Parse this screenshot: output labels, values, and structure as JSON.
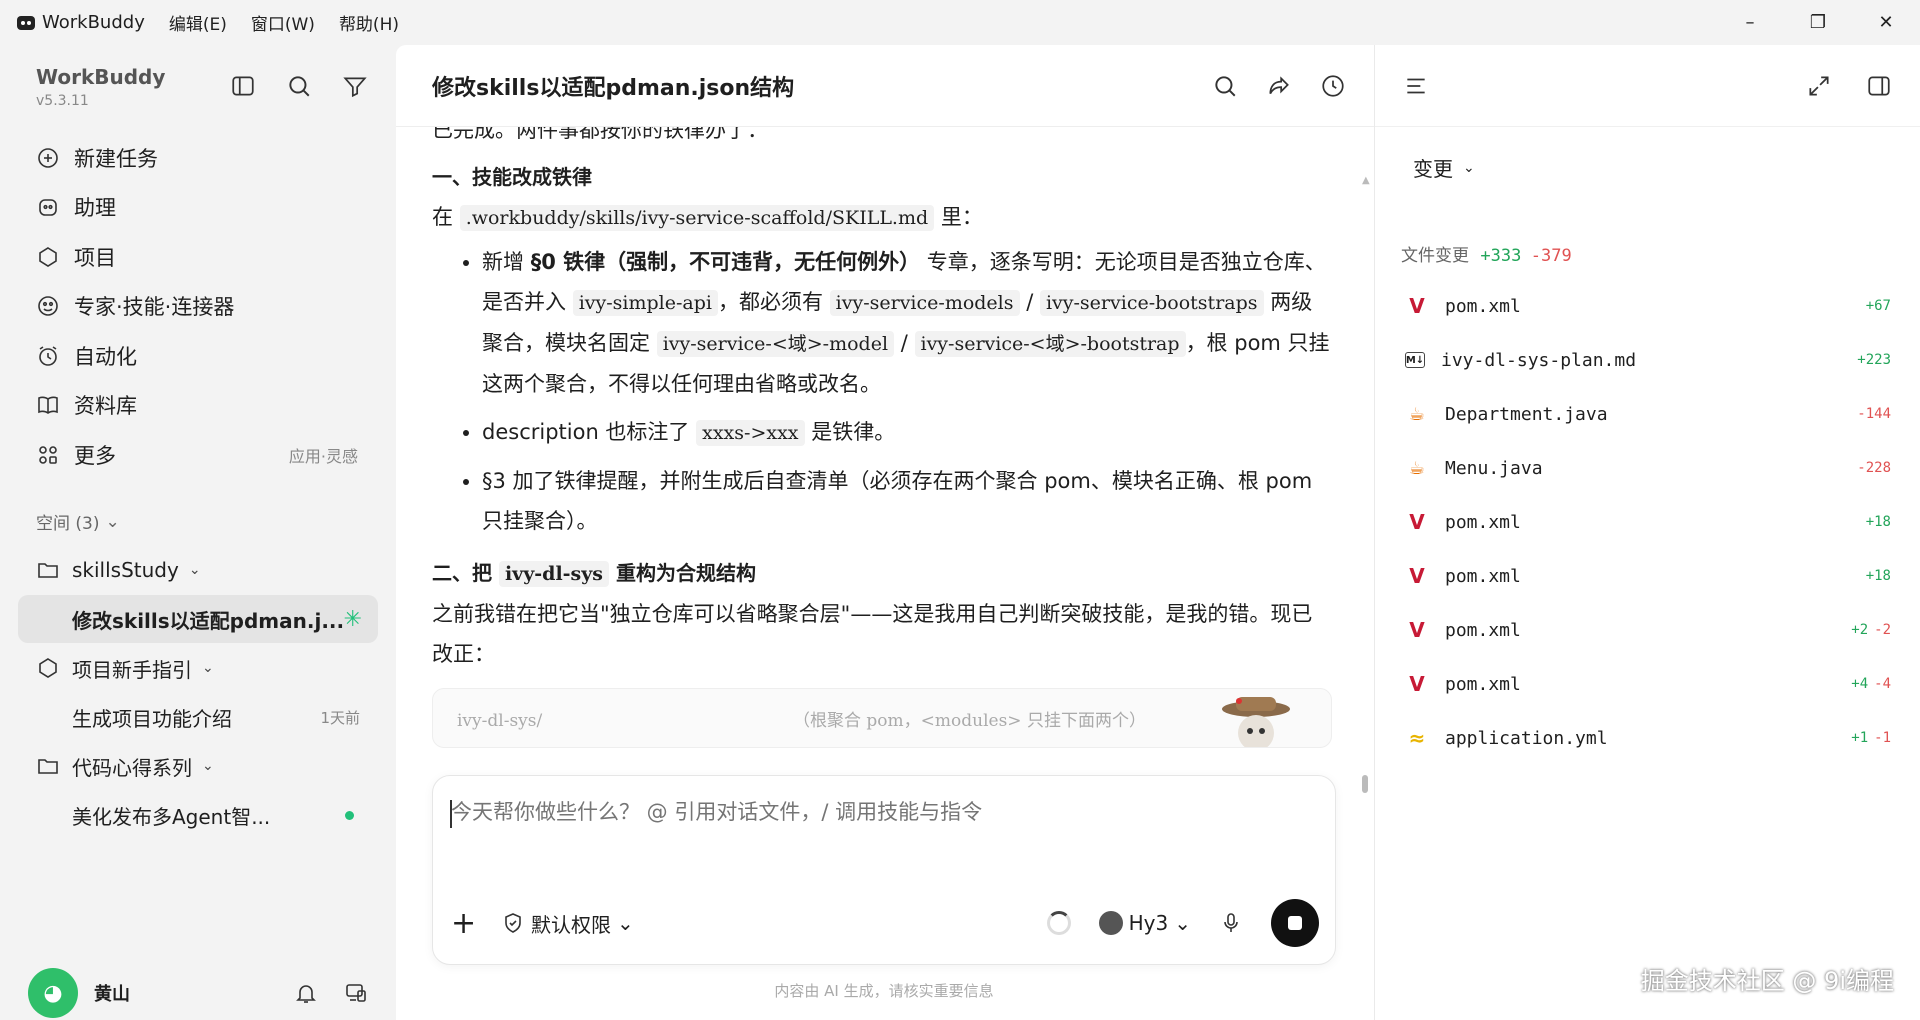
{
  "window": {
    "app_name": "WorkBuddy",
    "menus": [
      "编辑(E)",
      "窗口(W)",
      "帮助(H)"
    ],
    "controls": {
      "minimize": "–",
      "restore": "❐",
      "close": "✕"
    }
  },
  "sidebar": {
    "brand": "WorkBuddy",
    "version": "v5.3.11",
    "nav": [
      {
        "label": "新建任务",
        "icon": "new-task-icon"
      },
      {
        "label": "助理",
        "icon": "assistant-icon"
      },
      {
        "label": "项目",
        "icon": "project-icon"
      },
      {
        "label": "专家·技能·连接器",
        "icon": "expert-icon"
      },
      {
        "label": "自动化",
        "icon": "alarm-clock-icon"
      },
      {
        "label": "资料库",
        "icon": "book-icon"
      },
      {
        "label": "更多",
        "icon": "apps-icon",
        "hint": "应用·灵感"
      }
    ],
    "spaces_label": "空间 (3)",
    "tree": {
      "folder1": "skillsStudy",
      "task_active": "修改skills以适配pdman.j...",
      "folder2": "项目新手指引",
      "task2": "生成项目功能介绍",
      "task2_meta": "1天前",
      "folder3": "代码心得系列",
      "task3": "美化发布多Agent智..."
    },
    "user": {
      "name": "黄山"
    }
  },
  "main": {
    "title": "修改skills以适配pdman.json结构",
    "cut_line": "已完成。两件事都按你的铁律办了：",
    "section1": {
      "heading": "一、技能改成铁律",
      "intro_prefix": "在",
      "intro_path": ".workbuddy/skills/ivy-service-scaffold/SKILL.md",
      "intro_suffix": "里：",
      "b1_a": "新增",
      "b1_strong": "§0 铁律（强制，不可违背，无任何例外）",
      "b1_b": "专章，逐条写明：无论项目是否独立仓库、是否并入",
      "b1_code1": "ivy-simple-api",
      "b1_c": "，都必须有",
      "b1_code2": "ivy-service-models",
      "b1_sep1": "/",
      "b1_code3": "ivy-service-bootstraps",
      "b1_d": "两级聚合，模块名固定",
      "b1_code4": "ivy-service-<域>-model",
      "b1_sep2": "/",
      "b1_code5": "ivy-service-<域>-bootstrap",
      "b1_e": "，根 pom 只挂这两个聚合，不得以任何理由省略或改名。",
      "b2_a": "description 也标注了",
      "b2_code": "xxxs->xxx",
      "b2_b": "是铁律。",
      "b3": "§3 加了铁律提醒，并附生成后自查清单（必须存在两个聚合 pom、模块名正确、根 pom 只挂聚合）。"
    },
    "section2": {
      "heading_a": "二、把",
      "heading_code": "ivy-dl-sys",
      "heading_b": "重构为合规结构",
      "para": "之前我错在把它当\"独立仓库可以省略聚合层\"——这是我用自己判断突破技能，是我的错。现已改正："
    },
    "codeblock": {
      "path": "ivy-dl-sys/",
      "comment": "（根聚合 pom，<modules> 只挂下面两个）"
    },
    "composer": {
      "placeholder": "今天帮你做些什么？ @ 引用对话文件，/ 调用技能与指令",
      "permission": "默认权限",
      "model": "Hy3"
    },
    "disclaimer": "内容由 AI 生成，请核实重要信息"
  },
  "right": {
    "dropdown": "变更",
    "header_label": "文件变更",
    "total_add": "+333",
    "total_del": "-379",
    "files": [
      {
        "name": "pom.xml",
        "icon": "maven-icon",
        "add": "+67",
        "del": ""
      },
      {
        "name": "ivy-dl-sys-plan.md",
        "icon": "markdown-icon",
        "add": "+223",
        "del": ""
      },
      {
        "name": "Department.java",
        "icon": "java-icon",
        "add": "",
        "del": "-144"
      },
      {
        "name": "Menu.java",
        "icon": "java-icon",
        "add": "",
        "del": "-228"
      },
      {
        "name": "pom.xml",
        "icon": "maven-icon",
        "add": "+18",
        "del": ""
      },
      {
        "name": "pom.xml",
        "icon": "maven-icon",
        "add": "+18",
        "del": ""
      },
      {
        "name": "pom.xml",
        "icon": "maven-icon",
        "add": "+2",
        "del": "-2"
      },
      {
        "name": "pom.xml",
        "icon": "maven-icon",
        "add": "+4",
        "del": "-4"
      },
      {
        "name": "application.yml",
        "icon": "yaml-icon",
        "add": "+1",
        "del": "-1"
      }
    ],
    "colors": {
      "add": "#23a55a",
      "del": "#e05252",
      "maven": "#c71a36",
      "java": "#e76f00",
      "yaml": "#e8b400"
    }
  },
  "watermark": "掘金技术社区 @ 9i编程"
}
